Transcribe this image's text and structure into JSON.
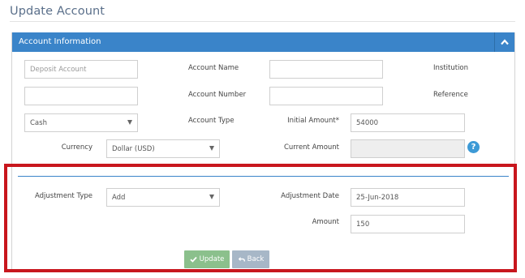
{
  "page": {
    "title": "Update Account"
  },
  "panel": {
    "title": "Account Information",
    "collapse_icon": "chevron-up-icon"
  },
  "form": {
    "deposit_account": {
      "placeholder": "Deposit Account",
      "value": ""
    },
    "account_name": {
      "label": "Account Name",
      "value": ""
    },
    "institution": {
      "label": "Institution"
    },
    "field_row2_left": {
      "value": ""
    },
    "account_number": {
      "label": "Account Number",
      "value": ""
    },
    "reference": {
      "label": "Reference"
    },
    "account_kind": {
      "value": "Cash"
    },
    "account_type": {
      "label": "Account Type"
    },
    "initial_amount": {
      "label": "Initial Amount*",
      "value": "54000"
    },
    "currency": {
      "label": "Currency",
      "value": "Dollar (USD)"
    },
    "current_amount": {
      "label": "Current Amount",
      "value": ""
    },
    "help": {
      "glyph": "?"
    }
  },
  "adjustment": {
    "type": {
      "label": "Adjustment Type",
      "value": "Add"
    },
    "date": {
      "label": "Adjustment Date",
      "value": "25-Jun-2018"
    },
    "amount": {
      "label": "Amount",
      "value": "150"
    }
  },
  "buttons": {
    "update": {
      "label": "Update",
      "icon": "check-icon"
    },
    "back": {
      "label": "Back",
      "icon": "reply-icon"
    }
  },
  "colors": {
    "header": "#3a84c9",
    "highlight": "#c8161d",
    "update_button": "#8bc08c",
    "back_button": "#a7b7c7"
  }
}
